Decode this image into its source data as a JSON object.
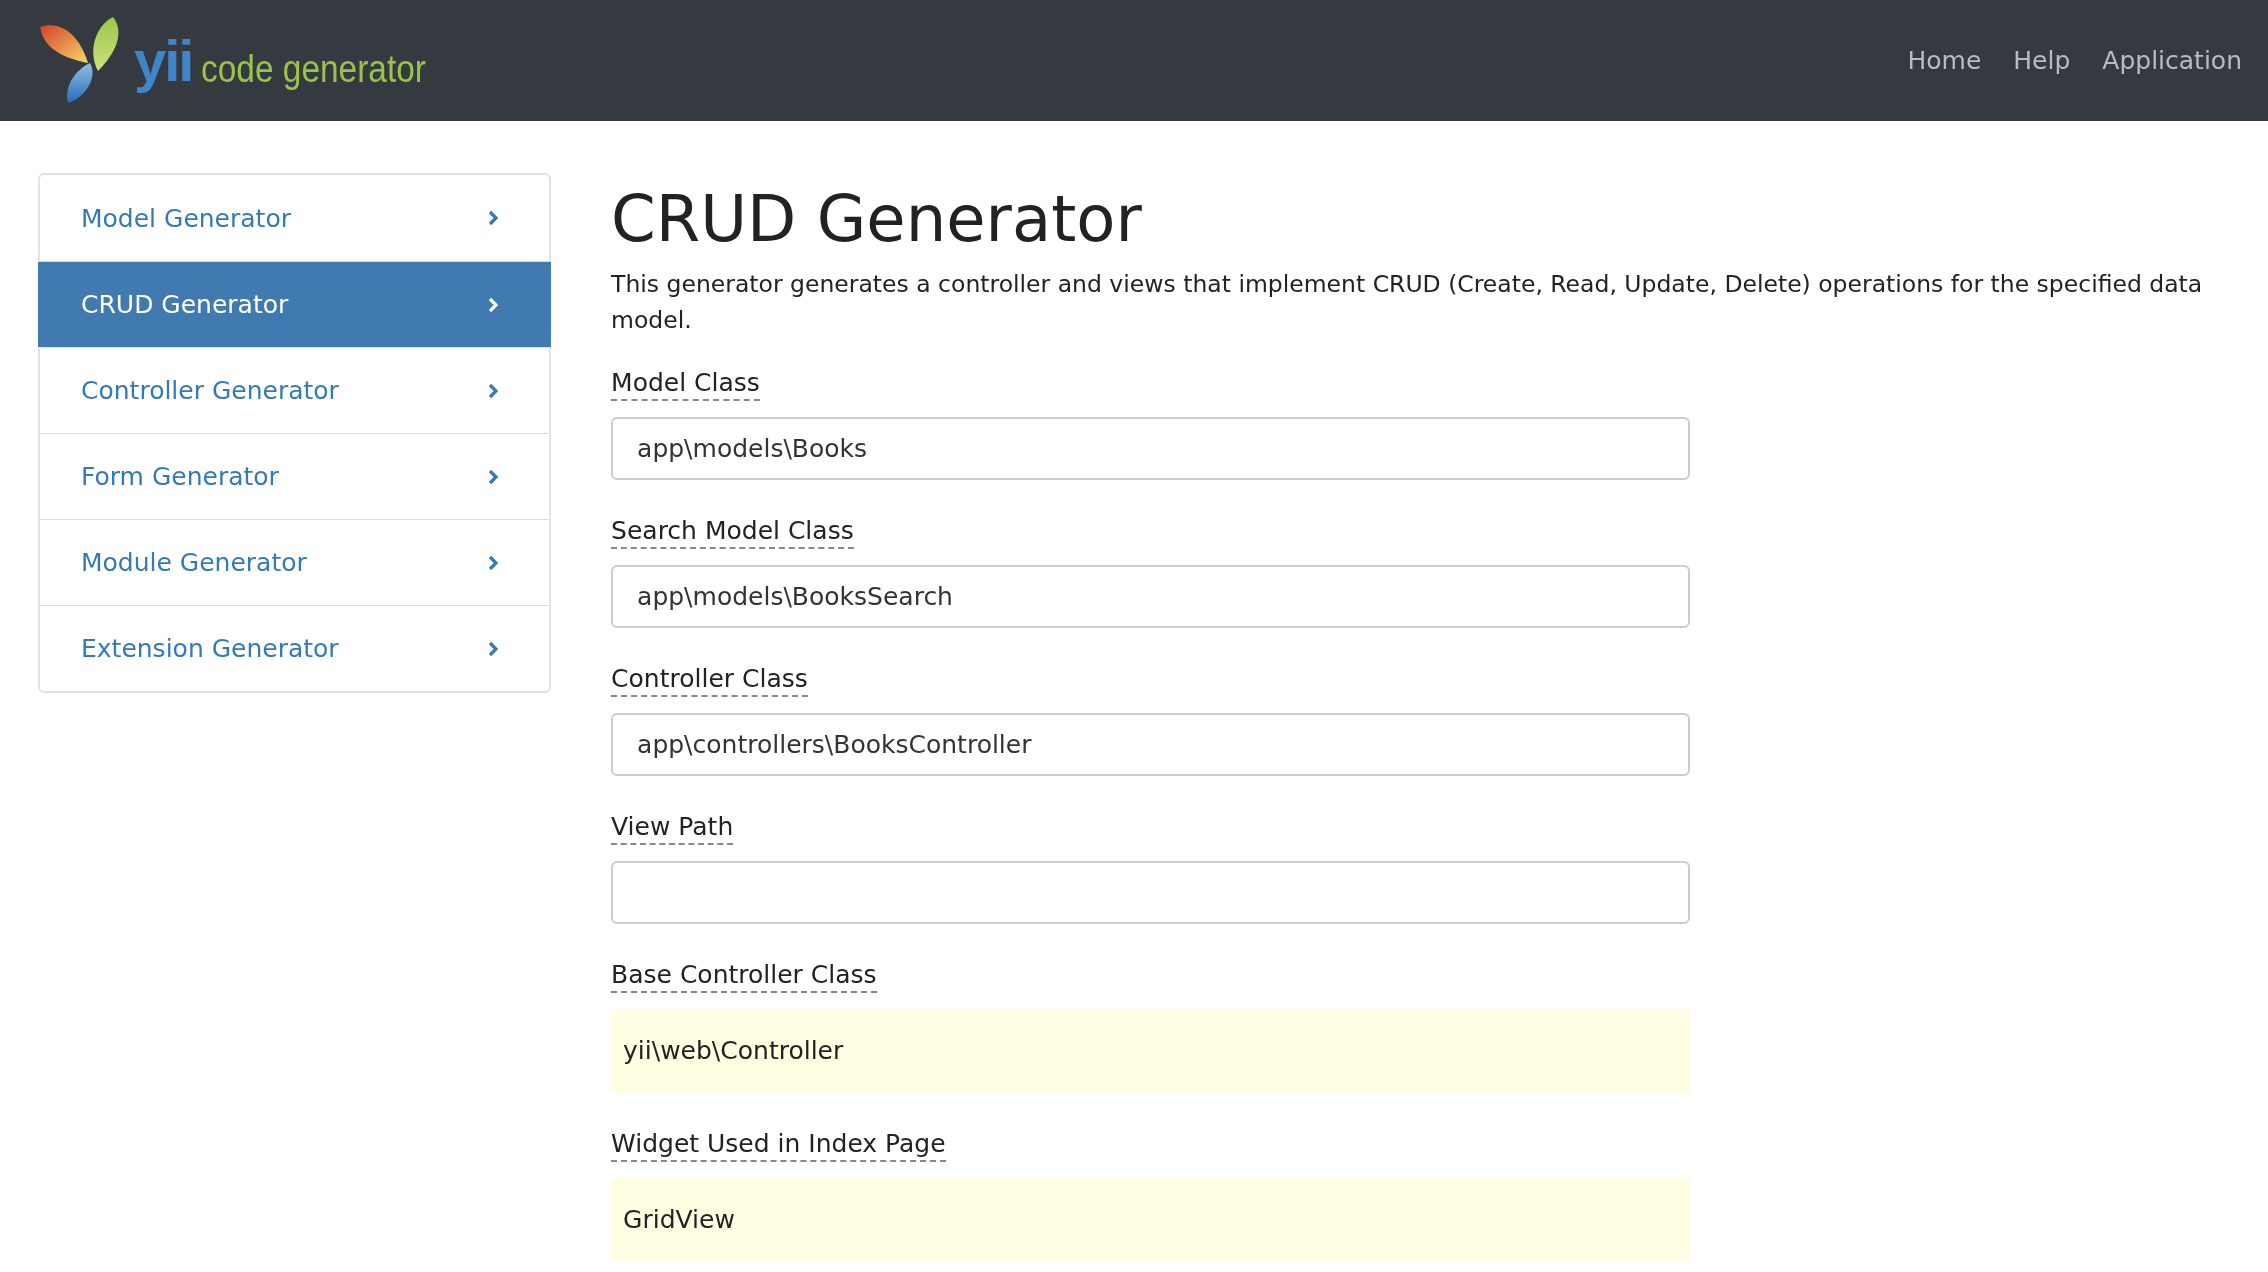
{
  "navbar": {
    "logo_main": "yii",
    "logo_sub": "code generator",
    "links": [
      {
        "label": "Home"
      },
      {
        "label": "Help"
      },
      {
        "label": "Application"
      }
    ]
  },
  "sidebar": {
    "items": [
      {
        "label": "Model Generator",
        "selected": false
      },
      {
        "label": "CRUD Generator",
        "selected": true
      },
      {
        "label": "Controller Generator",
        "selected": false
      },
      {
        "label": "Form Generator",
        "selected": false
      },
      {
        "label": "Module Generator",
        "selected": false
      },
      {
        "label": "Extension Generator",
        "selected": false
      }
    ]
  },
  "main": {
    "title": "CRUD Generator",
    "description": "This generator generates a controller and views that implement CRUD (Create, Read, Update, Delete) operations for the specified data model.",
    "fields": [
      {
        "label": "Model Class",
        "kind": "input",
        "value": "app\\models\\Books"
      },
      {
        "label": "Search Model Class",
        "kind": "input",
        "value": "app\\models\\BooksSearch"
      },
      {
        "label": "Controller Class",
        "kind": "input",
        "value": "app\\controllers\\BooksController"
      },
      {
        "label": "View Path",
        "kind": "input"
      },
      {
        "label": "Base Controller Class",
        "kind": "sticky",
        "value": "yii\\web\\Controller"
      },
      {
        "label": "Widget Used in Index Page",
        "kind": "sticky",
        "value": "GridView"
      }
    ]
  }
}
